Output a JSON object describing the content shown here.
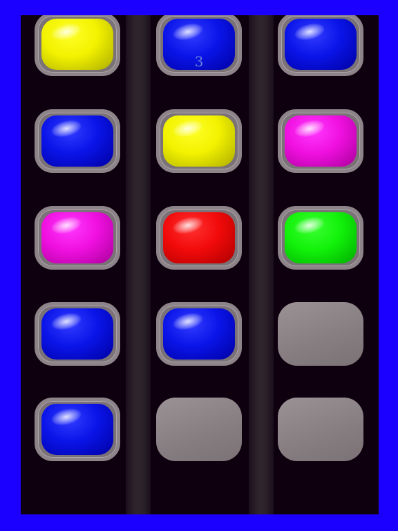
{
  "colors": {
    "frame": "#1c00ff",
    "board": "#0f0010",
    "empty_tile": "#8c8488"
  },
  "board": {
    "columns": [
      [
        "yellow",
        "blue",
        "magenta",
        "blue",
        "blue"
      ],
      [
        "blue",
        "yellow",
        "red",
        "blue",
        "empty"
      ],
      [
        "blue",
        "magenta",
        "green",
        "empty",
        "empty"
      ]
    ],
    "tile_labels": [
      {
        "column": 1,
        "row": 0,
        "text": "3"
      }
    ]
  },
  "piece_colors": {
    "yellow": "#f2f200",
    "blue": "#0a14e8",
    "magenta": "#f010e0",
    "red": "#f20a0a",
    "green": "#12f20a"
  }
}
